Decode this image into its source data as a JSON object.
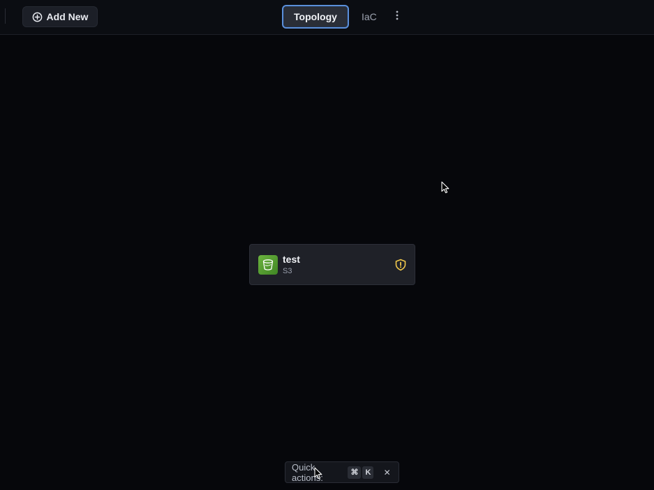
{
  "header": {
    "add_new_label": "Add New",
    "tabs": [
      {
        "label": "Topology",
        "active": true
      },
      {
        "label": "IaC",
        "active": false
      }
    ]
  },
  "canvas": {
    "nodes": [
      {
        "name": "test",
        "type": "S3",
        "icon": "s3-bucket-icon",
        "status_icon": "shield-warning-icon"
      }
    ]
  },
  "quick_actions": {
    "label": "Quick actions:",
    "keys": [
      "⌘",
      "K"
    ],
    "close_label": "✕"
  },
  "colors": {
    "accent": "#5b8fd9",
    "s3_green": "#4f9a2f",
    "warning_yellow": "#f2c94c"
  }
}
